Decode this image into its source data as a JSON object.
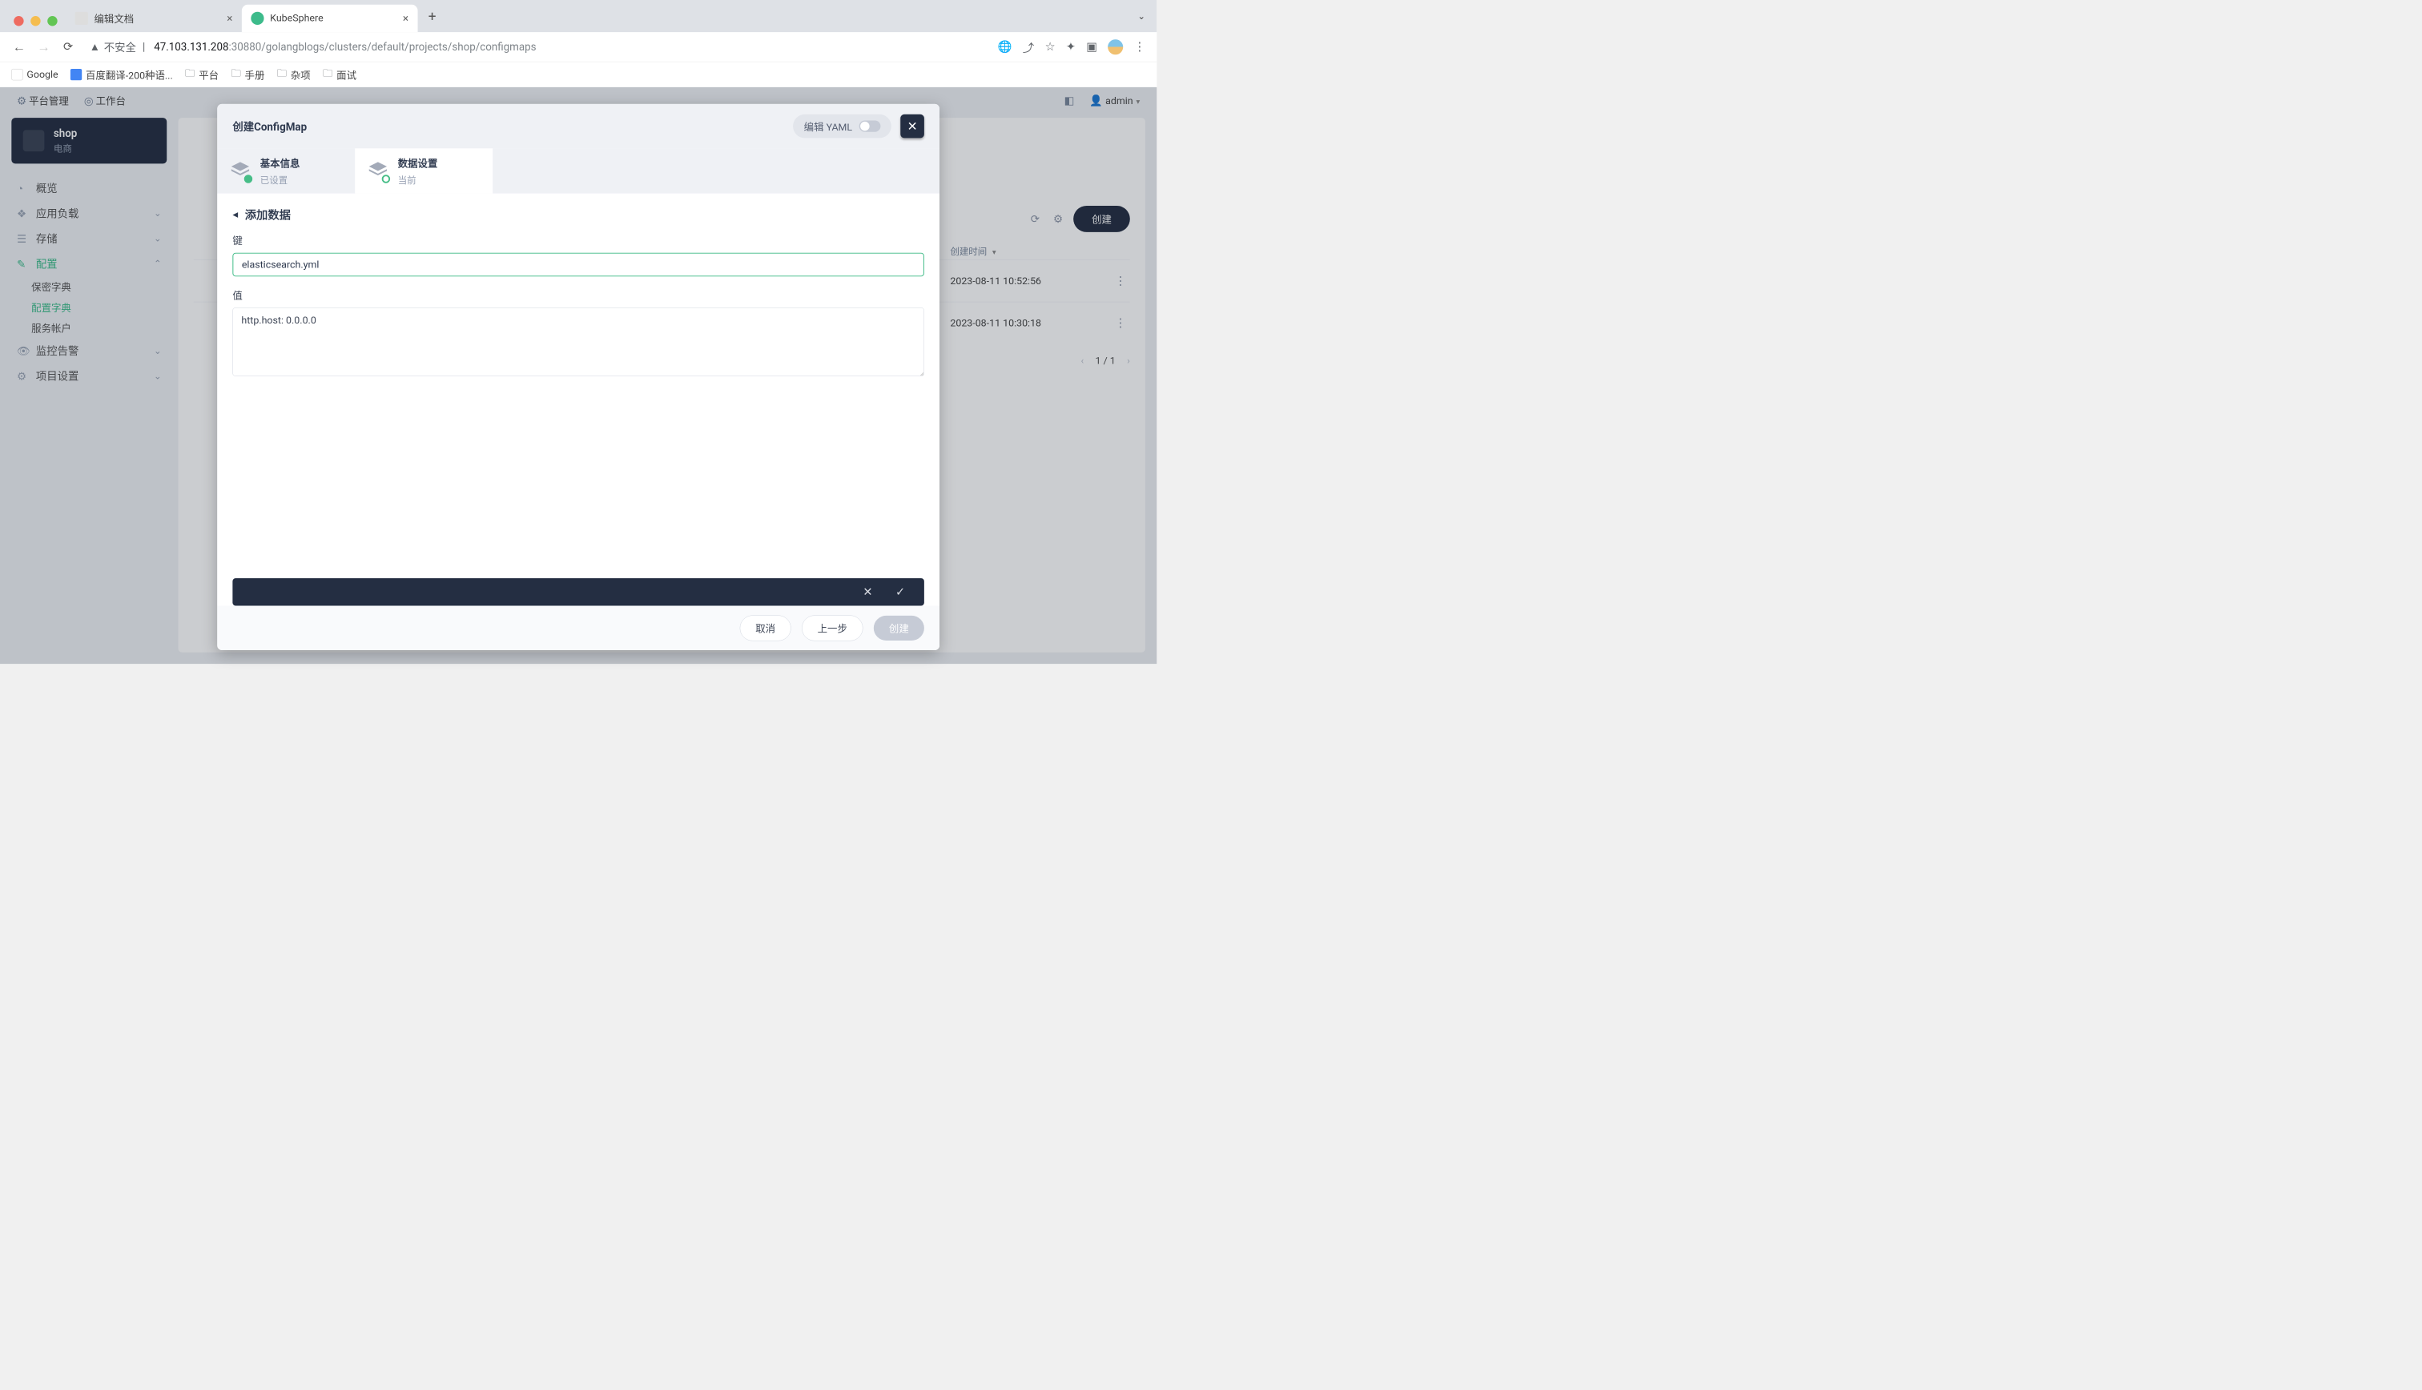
{
  "browser": {
    "tabs": [
      {
        "title": "编辑文档",
        "active": false
      },
      {
        "title": "KubeSphere",
        "active": true
      }
    ],
    "url_insecure_label": "不安全",
    "url_host": "47.103.131.208",
    "url_port_path": ":30880/golangblogs/clusters/default/projects/shop/configmaps",
    "bookmarks": [
      "Google",
      "百度翻译-200种语...",
      "平台",
      "手册",
      "杂项",
      "面试"
    ]
  },
  "topbar": {
    "platform": "平台管理",
    "workbench": "工作台",
    "user": "admin"
  },
  "sidebar": {
    "project_name": "shop",
    "project_sub": "电商",
    "items": [
      {
        "label": "概览"
      },
      {
        "label": "应用负载",
        "chev": true
      },
      {
        "label": "存储",
        "chev": true
      },
      {
        "label": "配置",
        "chev_open": true,
        "selected": true,
        "children": [
          {
            "label": "保密字典"
          },
          {
            "label": "配置字典",
            "selected": true
          },
          {
            "label": "服务帐户"
          }
        ]
      },
      {
        "label": "监控告警",
        "chev": true
      },
      {
        "label": "项目设置",
        "chev": true
      }
    ]
  },
  "main": {
    "create_btn": "创建",
    "col_time_header": "创建时间",
    "rows": [
      {
        "time": "2023-08-11 10:52:56"
      },
      {
        "time": "2023-08-11 10:30:18"
      }
    ],
    "pager": "1 / 1"
  },
  "modal": {
    "title": "创建ConfigMap",
    "yaml_label": "编辑 YAML",
    "steps": [
      {
        "title": "基本信息",
        "sub": "已设置",
        "state": "done"
      },
      {
        "title": "数据设置",
        "sub": "当前",
        "state": "current"
      }
    ],
    "back_label": "添加数据",
    "key_label": "键",
    "key_value": "elasticsearch.yml",
    "val_label": "值",
    "val_value": "http.host: 0.0.0.0",
    "cancel": "取消",
    "prev": "上一步",
    "create": "创建"
  }
}
